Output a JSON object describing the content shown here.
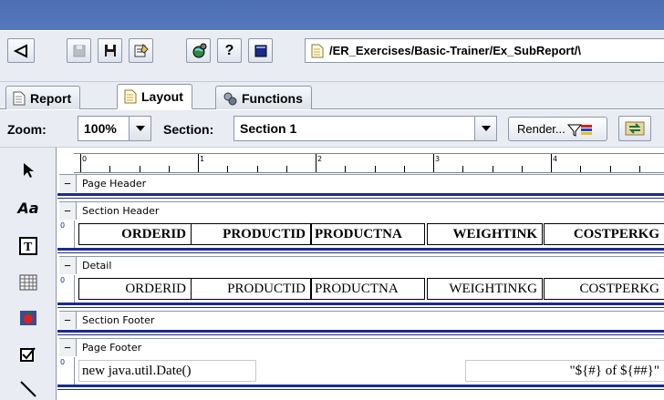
{
  "toolbar": {
    "path": "/ER_Exercises/Basic-Trainer/Ex_SubReport/\\"
  },
  "tabs": [
    {
      "label": "Report"
    },
    {
      "label": "Layout"
    },
    {
      "label": "Functions"
    }
  ],
  "options": {
    "zoom_label": "Zoom:",
    "zoom_value": "100%",
    "section_label": "Section:",
    "section_value": "Section 1",
    "render_label": "Render..."
  },
  "ruler": {
    "numbers": [
      "0",
      "1",
      "2",
      "3",
      "4"
    ]
  },
  "bands": {
    "page_header": "Page Header",
    "section_header": "Section Header",
    "detail": "Detail",
    "section_footer": "Section Footer",
    "page_footer": "Page Footer"
  },
  "header_fields": [
    "ORDERID",
    "PRODUCTID",
    "PRODUCTNA",
    "WEIGHTINK",
    "COSTPERKG"
  ],
  "detail_fields": [
    "ORDERID",
    "PRODUCTID",
    "PRODUCTNA",
    "WEIGHTINKG",
    "COSTPERKG"
  ],
  "footer_fields": {
    "date": "new java.util.Date()",
    "page": "\"${#} of ${##}\""
  },
  "row_marker": "0",
  "colors": {
    "title_bar": "#5072b8",
    "band_line": "#1d2a8f",
    "panel_bg": "#e9ecf2"
  }
}
